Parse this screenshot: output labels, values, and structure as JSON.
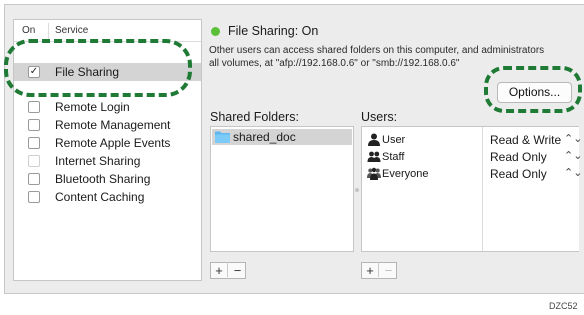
{
  "service_list": {
    "header_on": "On",
    "header_service": "Service",
    "items": [
      {
        "label": "File Sharing",
        "checked": true,
        "selected": true
      },
      {
        "label": "Remote Login",
        "checked": false
      },
      {
        "label": "Remote Management",
        "checked": false
      },
      {
        "label": "Remote Apple Events",
        "checked": false
      },
      {
        "label": "Internet Sharing",
        "checked": false,
        "disabled": true
      },
      {
        "label": "Bluetooth Sharing",
        "checked": false
      },
      {
        "label": "Content Caching",
        "checked": false
      }
    ]
  },
  "status": {
    "title": "File Sharing: On",
    "line1": "Other users can access shared folders on this computer, and administrators",
    "line2": "all volumes, at \"afp://192.168.0.6\" or \"smb://192.168.0.6\"",
    "color": "#5cbf3a"
  },
  "options_button": "Options...",
  "shared_folders": {
    "label": "Shared Folders:",
    "items": [
      "shared_doc"
    ]
  },
  "users": {
    "label": "Users:",
    "rows": [
      {
        "name": "User",
        "permission": "Read & Write",
        "icon": "single-user-icon"
      },
      {
        "name": "Staff",
        "permission": "Read Only",
        "icon": "group-icon"
      },
      {
        "name": "Everyone",
        "permission": "Read Only",
        "icon": "everyone-icon"
      }
    ]
  },
  "buttons": {
    "add": "+",
    "remove": "−"
  },
  "stepper_glyph": "⌃⌄",
  "figure_code": "DZC52",
  "callout_color": "#1f7a35"
}
